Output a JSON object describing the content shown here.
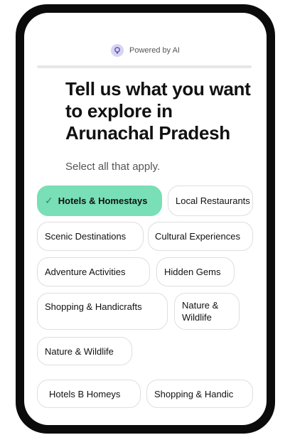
{
  "header": {
    "powered_label": "Powered by AI",
    "icon": "ai-icon"
  },
  "progress": {
    "fraction": 0
  },
  "title": "Tell us what you want to explore in Arunachal Pradesh",
  "subtitle": "Select all that apply.",
  "chips": [
    {
      "label": "Hotels & Homestays",
      "selected": true
    },
    {
      "label": "Local Restaurants",
      "selected": false
    },
    {
      "label": "Scenic Destinations",
      "selected": false
    },
    {
      "label": "Cultural Experiences",
      "selected": false
    },
    {
      "label": "Adventure Activities",
      "selected": false
    },
    {
      "label": "Hidden Gems",
      "selected": false
    },
    {
      "label": "Shopping & Handicrafts",
      "selected": false
    },
    {
      "label": "Nature & Wildlife",
      "selected": false
    },
    {
      "label": "Nature & Wildlife",
      "selected": false
    },
    {
      "label": "Hotels B Homeys",
      "selected": false
    },
    {
      "label": "Shopping & Handic",
      "selected": false
    }
  ],
  "colors": {
    "selected": "#79dfb6",
    "frame": "#0b0b0b",
    "accent_icon": "#d7d3f2"
  }
}
